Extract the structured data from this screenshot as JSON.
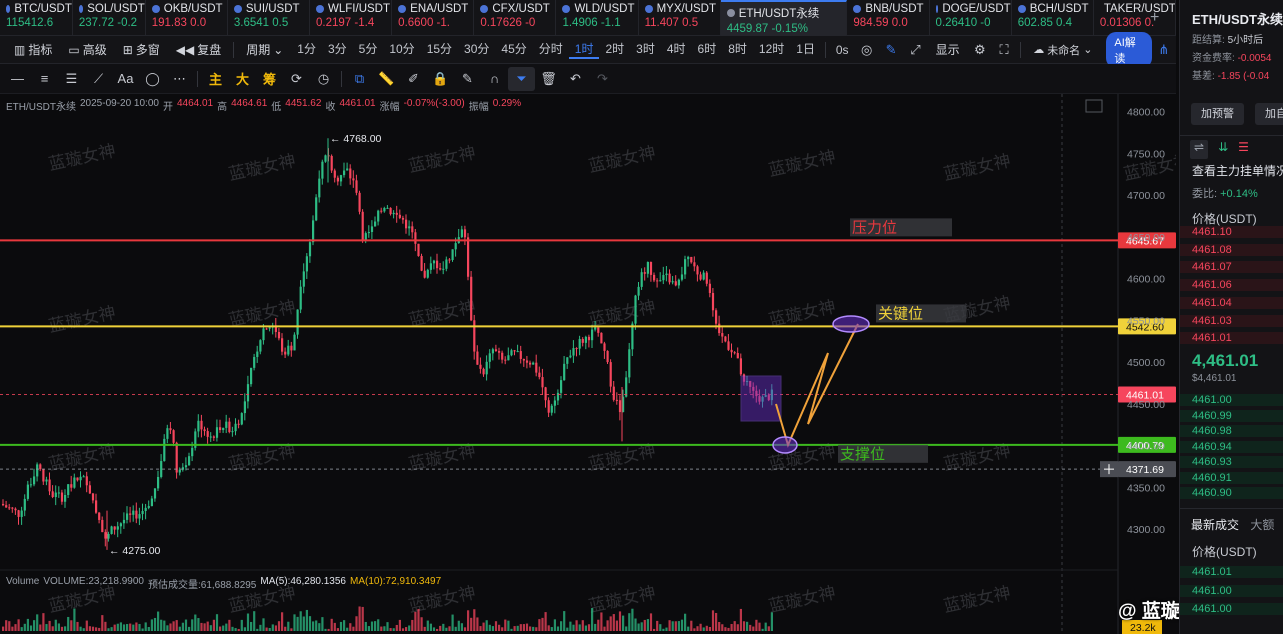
{
  "tabs": [
    {
      "symbol": "BTC/USDT",
      "value": "115412.6",
      "dir": "up"
    },
    {
      "symbol": "SOL/USDT",
      "value": "237.72 -0.2",
      "dir": "up"
    },
    {
      "symbol": "OKB/USDT",
      "value": "191.83 0.0",
      "dir": "dn"
    },
    {
      "symbol": "SUI/USDT",
      "value": "3.6541 0.5",
      "dir": "up"
    },
    {
      "symbol": "WLFI/USDT",
      "value": "0.2197 -1.4",
      "dir": "dn"
    },
    {
      "symbol": "ENA/USDT",
      "value": "0.6600 -1.",
      "dir": "dn"
    },
    {
      "symbol": "CFX/USDT",
      "value": "0.17626 -0",
      "dir": "dn"
    },
    {
      "symbol": "WLD/USDT",
      "value": "1.4906 -1.1",
      "dir": "up"
    },
    {
      "symbol": "MYX/USDT",
      "value": "11.407 0.5",
      "dir": "dn"
    },
    {
      "symbol": "ETH/USDT永续",
      "value": "4459.87 -0.15%",
      "dir": "up",
      "active": true
    },
    {
      "symbol": "BNB/USDT",
      "value": "984.59 0.0",
      "dir": "dn"
    },
    {
      "symbol": "DOGE/USDT",
      "value": "0.26410 -0",
      "dir": "up"
    },
    {
      "symbol": "BCH/USDT",
      "value": "602.85 0.4",
      "dir": "up"
    },
    {
      "symbol": "TAKER/USDT",
      "value": "0.01306 0.",
      "dir": "dn"
    }
  ],
  "toolbar": {
    "indicators": "指标",
    "advanced": "高级",
    "multi": "多窗",
    "replay": "复盘",
    "period": "周期",
    "intervals": [
      "1分",
      "3分",
      "5分",
      "10分",
      "15分",
      "30分",
      "45分",
      "分时",
      "1时",
      "2时",
      "3时",
      "4时",
      "6时",
      "8时",
      "12时",
      "1日"
    ],
    "selected_interval": "1时",
    "countdown": "0s",
    "display": "显示",
    "unnamed": "未命名",
    "ai": "AI解读"
  },
  "drawing_tools": {
    "main": "主",
    "big": "大",
    "chip": "筹"
  },
  "legend": {
    "symbol": "ETH/USDT永续",
    "datetime": "2025-09-20 10:00",
    "open_label": "开",
    "open": "4464.01",
    "high_label": "高",
    "high": "4464.61",
    "low_label": "低",
    "low": "4451.62",
    "close_label": "收",
    "close": "4461.01",
    "change_label": "涨幅",
    "change": "-0.07%(-3.00)",
    "amp_label": "振幅",
    "amp": "0.29%"
  },
  "volume_legend": {
    "label": "Volume",
    "volume": "VOLUME:23,218.9900",
    "predicted": "预估成交量:61,688.8295",
    "ma5": "MA(5):46,280.1356",
    "ma10": "MA(10):72,910.3497"
  },
  "chart_data": {
    "type": "candlestick",
    "y_ticks": [
      "4800.00",
      "4750.00",
      "4700.00",
      "4650.00",
      "4600.00",
      "4550.00",
      "4500.00",
      "4450.00",
      "4400.00",
      "4350.00",
      "4300.00"
    ],
    "ylim": [
      4290,
      4810
    ],
    "high_marker": "4768.00",
    "low_marker": "4275.00",
    "levels": [
      {
        "price": 4645.67,
        "label": "4645.67",
        "name": "压力位",
        "color": "#e8383d"
      },
      {
        "price": 4542.6,
        "label": "4542.60",
        "name": "关键位",
        "color": "#f0d23a"
      },
      {
        "price": 4400.79,
        "label": "4400.79",
        "name": "支撑位",
        "color": "#3dba1e"
      },
      {
        "price": 4461.01,
        "label": "4461.01",
        "color": "#f6465d"
      },
      {
        "price": 4371.69,
        "label": "4371.69",
        "color": "#9aa0aa"
      }
    ],
    "volume_label": "23.2k",
    "watermark": "蓝璇女神"
  },
  "brand_overlay": "@ 蓝璇女神",
  "right_panel": {
    "title": "ETH/USDT永续",
    "settle_label": "距结算:",
    "settle_value": "5小时后",
    "funding_label": "资金费率:",
    "funding_value": "-0.0054",
    "basis_label": "基差:",
    "basis_value": "-1.85 (-0.04",
    "alert_button": "加预警",
    "add_button": "加自",
    "orderbook_title": "查看主力挂单情况",
    "ratio_label": "委比:",
    "ratio_value": "+0.14%",
    "price_header": "价格(USDT)",
    "asks": [
      "4461.10",
      "4461.08",
      "4461.07",
      "4461.06",
      "4461.04",
      "4461.03",
      "4461.01"
    ],
    "last_price": "4,461.01",
    "last_price_sub": "$4,461.01",
    "bids": [
      "4461.00",
      "4460.99",
      "4460.98",
      "4460.94",
      "4460.93",
      "4460.91",
      "4460.90"
    ],
    "trades_tab": "最新成交",
    "big_tab": "大额",
    "trades_price_header": "价格(USDT)",
    "trades": [
      "4461.01",
      "4461.00",
      "4461.00"
    ]
  }
}
